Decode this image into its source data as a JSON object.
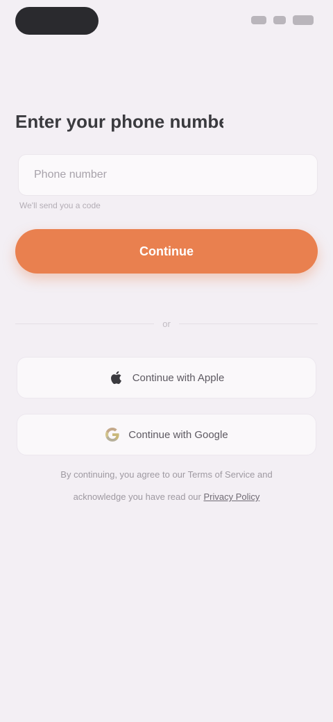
{
  "header": {
    "title": "Enter your phone number"
  },
  "phone_input": {
    "placeholder": "Phone number",
    "value": ""
  },
  "helper": {
    "text": "We'll send you a code"
  },
  "primary_button": {
    "label": "Continue"
  },
  "divider": {
    "text": "or"
  },
  "social": {
    "apple_label": "Continue with Apple",
    "google_label": "Continue with Google"
  },
  "terms": {
    "line1": "By continuing, you agree to our Terms of Service and",
    "line2_prefix": "acknowledge you have read our ",
    "line2_link": "Privacy Policy"
  },
  "colors": {
    "accent": "#e9804f",
    "background": "#f3eff4"
  },
  "icons": {
    "apple": "apple-icon",
    "google": "google-icon"
  }
}
